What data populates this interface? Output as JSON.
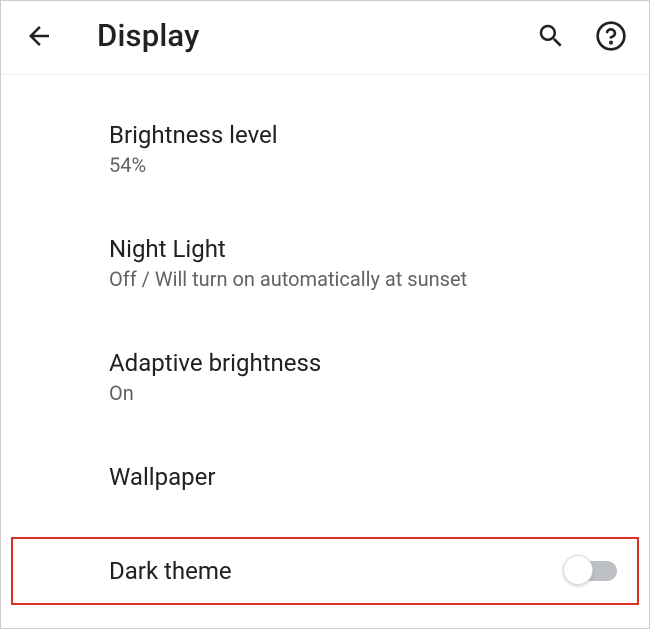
{
  "header": {
    "title": "Display"
  },
  "settings": {
    "brightness": {
      "title": "Brightness level",
      "value": "54%"
    },
    "nightLight": {
      "title": "Night Light",
      "value": "Off / Will turn on automatically at sunset"
    },
    "adaptiveBrightness": {
      "title": "Adaptive brightness",
      "value": "On"
    },
    "wallpaper": {
      "title": "Wallpaper"
    },
    "darkTheme": {
      "title": "Dark theme",
      "enabled": false
    }
  }
}
